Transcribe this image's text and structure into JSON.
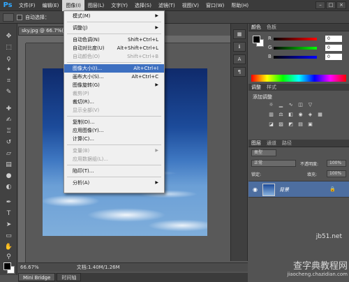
{
  "menubar": {
    "logo": "Ps",
    "items": [
      "文件(F)",
      "编辑(E)",
      "图像(I)",
      "图层(L)",
      "文字(Y)",
      "选择(S)",
      "滤镜(T)",
      "视图(V)",
      "窗口(W)",
      "帮助(H)"
    ]
  },
  "options": {
    "auto_select_label": "自动选择："
  },
  "document": {
    "tab_title": "sky.jpg @ 66.7%(RGB/8)",
    "zoom": "66.67%",
    "doc_info": "文档:1.40M/1.26M"
  },
  "bottom_tabs": [
    "Mini Bridge",
    "时间轴"
  ],
  "dropdown": {
    "items": [
      {
        "label": "模式(M)",
        "shortcut": "",
        "submenu": true,
        "disabled": false
      },
      {
        "sep": true
      },
      {
        "label": "调整(J)",
        "shortcut": "",
        "submenu": true,
        "disabled": false
      },
      {
        "sep": true
      },
      {
        "label": "自动色调(N)",
        "shortcut": "Shift+Ctrl+L",
        "disabled": false
      },
      {
        "label": "自动对比度(U)",
        "shortcut": "Alt+Shift+Ctrl+L",
        "disabled": false
      },
      {
        "label": "自动颜色(O)",
        "shortcut": "Shift+Ctrl+B",
        "disabled": true
      },
      {
        "sep": true
      },
      {
        "label": "图像大小(I)...",
        "shortcut": "Alt+Ctrl+I",
        "disabled": false,
        "highlight": true
      },
      {
        "label": "画布大小(S)...",
        "shortcut": "Alt+Ctrl+C",
        "disabled": false
      },
      {
        "label": "图像旋转(G)",
        "shortcut": "",
        "submenu": true,
        "disabled": false
      },
      {
        "label": "裁剪(P)",
        "shortcut": "",
        "disabled": true
      },
      {
        "label": "裁切(R)...",
        "shortcut": "",
        "disabled": false
      },
      {
        "label": "显示全部(V)",
        "shortcut": "",
        "disabled": true
      },
      {
        "sep": true
      },
      {
        "label": "复制(D)...",
        "shortcut": "",
        "disabled": false
      },
      {
        "label": "应用图像(Y)...",
        "shortcut": "",
        "disabled": false
      },
      {
        "label": "计算(C)...",
        "shortcut": "",
        "disabled": false
      },
      {
        "sep": true
      },
      {
        "label": "变量(B)",
        "shortcut": "",
        "submenu": true,
        "disabled": true
      },
      {
        "label": "应用数据组(L)...",
        "shortcut": "",
        "disabled": true
      },
      {
        "sep": true
      },
      {
        "label": "陷印(T)...",
        "shortcut": "",
        "disabled": false
      },
      {
        "sep": true
      },
      {
        "label": "分析(A)",
        "shortcut": "",
        "submenu": true,
        "disabled": false
      }
    ]
  },
  "panels": {
    "color_tabs": [
      "颜色",
      "色板"
    ],
    "sliders": [
      {
        "letter": "R",
        "value": "0",
        "color": "#ff0000"
      },
      {
        "letter": "G",
        "value": "0",
        "color": "#00ff00"
      },
      {
        "letter": "B",
        "value": "0",
        "color": "#0000ff"
      }
    ],
    "adjust_tabs": [
      "调整",
      "样式"
    ],
    "adjust_title": "添加调整",
    "layers_tabs": [
      "图层",
      "通道",
      "路径"
    ],
    "kind_label": "类型",
    "blend_mode": "正常",
    "opacity_label": "不透明度:",
    "opacity_value": "100%",
    "lock_label": "锁定:",
    "fill_label": "填充:",
    "fill_value": "100%",
    "layer_name": "背景"
  },
  "watermark": {
    "line1": "查字典教程网",
    "line2": "jiaocheng.chazidian.com",
    "site": "jb51.net"
  }
}
